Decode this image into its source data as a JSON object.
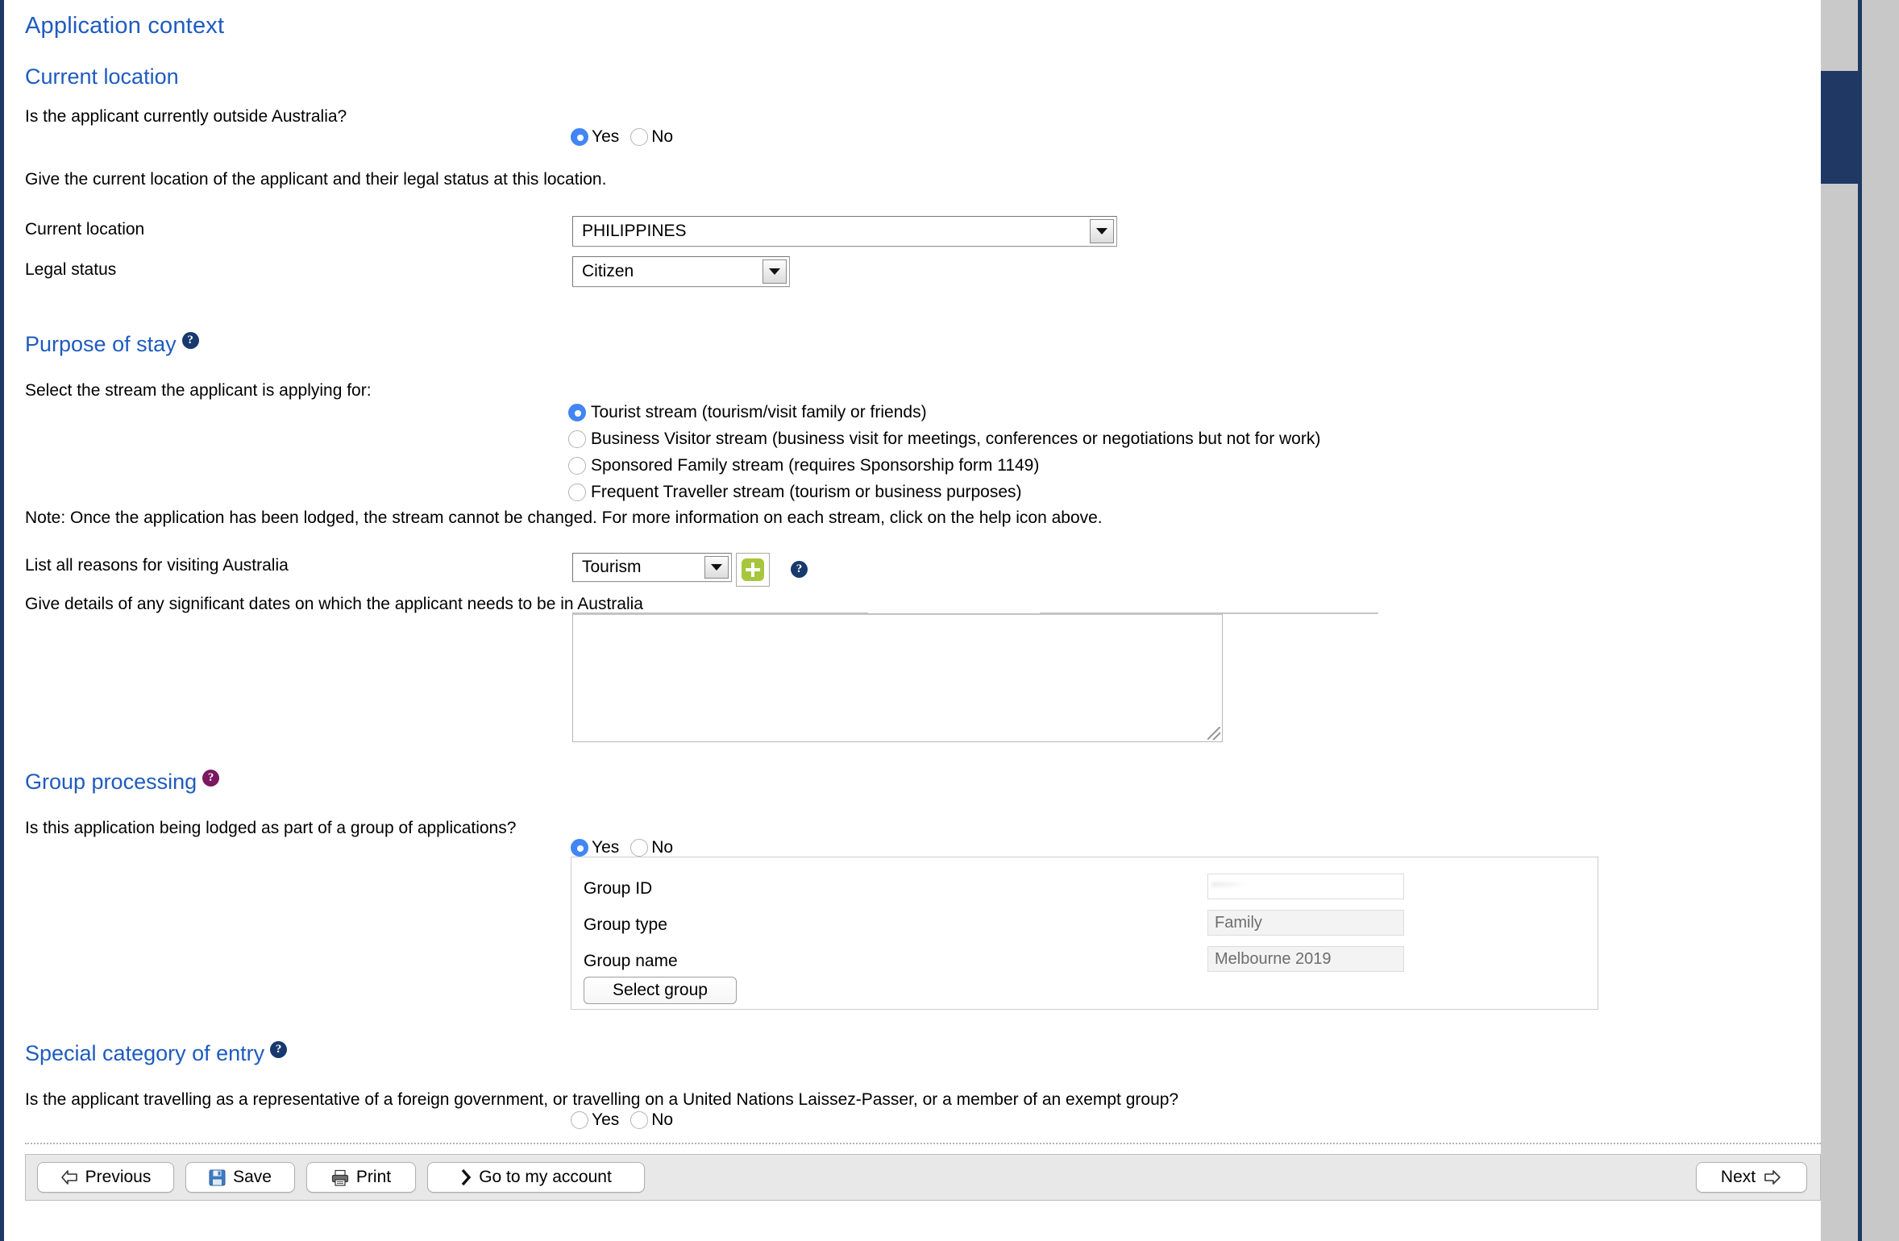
{
  "page": {
    "title": "Application context"
  },
  "current_location": {
    "heading": "Current location",
    "question": "Is the applicant currently outside Australia?",
    "answer_yes": "Yes",
    "answer_no": "No",
    "selected": "Yes",
    "instruction": "Give the current location of the applicant and their legal status at this location.",
    "location_label": "Current location",
    "location_value": "PHILIPPINES",
    "legal_status_label": "Legal status",
    "legal_status_value": "Citizen"
  },
  "purpose_of_stay": {
    "heading": "Purpose of stay",
    "help_icon": "help-icon",
    "prompt": "Select the stream the applicant is applying for:",
    "streams": [
      {
        "label": "Tourist stream (tourism/visit family or friends)",
        "selected": true
      },
      {
        "label": "Business Visitor stream (business visit for meetings, conferences or negotiations but not for work)",
        "selected": false
      },
      {
        "label": "Sponsored Family stream (requires Sponsorship form 1149)",
        "selected": false
      },
      {
        "label": "Frequent Traveller stream (tourism or business purposes)",
        "selected": false
      }
    ],
    "note": "Note: Once the application has been lodged, the stream cannot be changed. For more information on each stream, click on the help icon above.",
    "reasons_label": "List all reasons for visiting Australia",
    "reasons_value": "Tourism",
    "add_button": "add-icon",
    "reasons_help_icon": "help-icon",
    "dates_label": "Give details of any significant dates on which the applicant needs to be in Australia",
    "dates_value": ""
  },
  "group_processing": {
    "heading": "Group processing",
    "help_icon": "help-icon",
    "question": "Is this application being lodged as part of a group of applications?",
    "answer_yes": "Yes",
    "answer_no": "No",
    "selected": "Yes",
    "fields": [
      {
        "label": "Group ID",
        "value": "",
        "redacted": true
      },
      {
        "label": "Group type",
        "value": "Family",
        "redacted": false
      },
      {
        "label": "Group name",
        "value": "Melbourne 2019",
        "redacted": false
      }
    ],
    "select_group_button": "Select group"
  },
  "special_category": {
    "heading": "Special category of entry",
    "help_icon": "help-icon",
    "question": "Is the applicant travelling as a representative of a foreign government, or travelling on a United Nations Laissez-Passer, or a member of an exempt group?",
    "answer_yes": "Yes",
    "answer_no": "No",
    "selected": ""
  },
  "footer": {
    "previous": "Previous",
    "save": "Save",
    "print": "Print",
    "account": "Go to my account",
    "next": "Next"
  },
  "colors": {
    "heading_blue": "#1f5bbf",
    "help_blue": "#17396e",
    "help_purple": "#7b1860",
    "radio_blue": "#4285f4",
    "add_green": "#a6c63c",
    "frame_navy": "#1f3864"
  }
}
